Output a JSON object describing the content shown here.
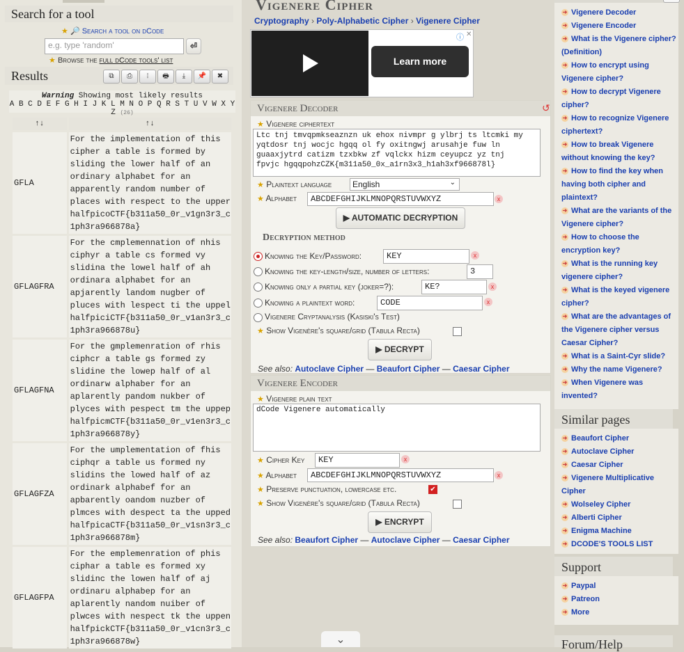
{
  "search": {
    "header": "Search for a tool",
    "link_label": "🔎 Search a tool on dCode",
    "placeholder": "e.g. type 'random'",
    "go_label": "⏎",
    "browse_prefix": "Browse the",
    "browse_link": "full dCode tools' list"
  },
  "results": {
    "header": "Results",
    "toolbar": [
      "⧉",
      "⎙",
      "⦙",
      "🖶",
      "⤓",
      "📌",
      "✖"
    ],
    "warning_label": "Warning",
    "warning_text": "Showing most likely results",
    "alphabet": "A B C D E F G H I J K L M N O P Q R S T U V W X Y Z",
    "alphabet_count": "(26)",
    "col_headers": [
      "↑↓",
      "↑↓"
    ],
    "rows": [
      {
        "key": "GFLA",
        "text": "For the implementation of this\ncipher a table is formed by\nsliding the lower half of an\nordinary alphabet for an\napparently random number of\nplaces with respect to the upper\nhalfpicoCTF{b311a50_0r_v1gn3r3_c\n1ph3ra966878a}"
      },
      {
        "key": "GFLAGFRA",
        "text": "For the cmplemennation of nhis\nciphyr a table cs formed vy\nslidina the lowel half of ah\nordinara alphabet for an\napjarently landom nugber of\npluces with lespect ti the uppel\nhalfpiciCTF{b311a50_0r_v1an3r3_c\n1ph3ra966878u}"
      },
      {
        "key": "GFLAGFNA",
        "text": "For the gmplemenration of rhis\nciphcr a table gs formed zy\nslidine the lowep half of al\nordinarw alphaber for an\naplarently pandom nukber of\nplyces with pespect tm the uppep\nhalfpicmCTF{b311a50_0r_v1en3r3_c\n1ph3ra966878y}"
      },
      {
        "key": "GFLAGFZA",
        "text": "For the umplementation of fhis\nciphqr a table us formed ny\nslidins the lowed half of az\nordinark alphabef for an\napbarently oandom nuzber of\nplmces with despect ta the upped\nhalfpicaCTF{b311a50_0r_v1sn3r3_c\n1ph3ra966878m}"
      },
      {
        "key": "GFLAGFPA",
        "text": "For the emplemenration of phis\nciphar a table es formed xy\nslidinc the lowen half of aj\nordinaru alphabep for an\naplarently nandom nuiber of\nplwces with nespect tk the uppen\nhalfpickCTF{b311a50_0r_v1cn3r3_c\n1ph3ra966878w}"
      }
    ]
  },
  "title": {
    "heading": "Vigenere Cipher",
    "breadcrumb": [
      "Cryptography",
      "Poly-Alphabetic Cipher",
      "Vigenere Cipher"
    ],
    "ad_button": "Learn more"
  },
  "decoder": {
    "header": "Vigenere Decoder",
    "ciphertext_label": "Vigenere ciphertext",
    "ciphertext": "Ltc tnj tmvqpmkseaznzn uk ehox nivmpr g ylbrj ts ltcmki my\nyqtdosr tnj wocjc hgqq ol fy oxitngwj arusahje fuw ln\nguaaxjytrd catizm tzxbkw zf vqlckx hizm ceyupcz yz tnj\nfpvjc hgqqpohzCZK{m311a50_0x_a1rn3x3_h1ah3xf966878l}",
    "lang_label": "Plaintext language",
    "lang_value": "English",
    "alphabet_label": "Alphabet",
    "alphabet_value": "ABCDEFGHIJKLMNOPQRSTUVWXYZ",
    "auto_button": "▶ AUTOMATIC DECRYPTION",
    "method_header": "Decryption method",
    "method_options": [
      {
        "label": "Knowing the Key/Password:",
        "value": "KEY"
      },
      {
        "label": "Knowing the key-length/size, number of letters:",
        "value": "3"
      },
      {
        "label": "Knowing only a partial key (joker=?):",
        "value": "KE?"
      },
      {
        "label": "Knowing a plaintext word:",
        "value": "CODE"
      },
      {
        "label": "Vigenere Cryptanalysis (Kasiski's Test)",
        "value": ""
      }
    ],
    "show_grid_label": "Show Vigenère's square/grid (Tabula Recta)",
    "decrypt_button": "▶ DECRYPT",
    "see_also_label": "See also:",
    "see_also": [
      "Autoclave Cipher",
      "Beaufort Cipher",
      "Caesar Cipher"
    ]
  },
  "encoder": {
    "header": "Vigenere Encoder",
    "plain_label": "Vigenere plain text",
    "plain_value": "dCode Vigenere automatically",
    "key_label": "Cipher Key",
    "key_value": "KEY",
    "alphabet_label": "Alphabet",
    "alphabet_value": "ABCDEFGHIJKLMNOPQRSTUVWXYZ",
    "preserve_label": "Preserve punctuation, lowercase etc.",
    "show_grid_label": "Show Vigenère's square/grid (Tabula Recta)",
    "encrypt_button": "▶ ENCRYPT",
    "see_also_label": "See also:",
    "see_also": [
      "Beaufort Cipher",
      "Autoclave Cipher",
      "Caesar Cipher"
    ]
  },
  "faq": [
    "Vigenere Decoder",
    "Vigenere Encoder",
    "What is the Vigenere cipher? (Definition)",
    "How to encrypt using Vigenere cipher?",
    "How to decrypt Vigenere cipher?",
    "How to recognize Vigenere ciphertext?",
    "How to break Vigenere without knowing the key?",
    "How to find the key when having both cipher and plaintext?",
    "What are the variants of the Vigenere cipher?",
    "How to choose the encryption key?",
    "What is the running key vigenere cipher?",
    "What is the keyed vigenere cipher?",
    "What are the advantages of the Vigenere cipher versus Caesar Cipher?",
    "What is a Saint-Cyr slide?",
    "Why the name Vigenere?",
    "When Vigenere was invented?"
  ],
  "similar": {
    "header": "Similar pages",
    "items": [
      "Beaufort Cipher",
      "Autoclave Cipher",
      "Caesar Cipher",
      "Vigenere Multiplicative Cipher",
      "Wolseley Cipher",
      "Alberti Cipher",
      "Enigma Machine",
      "DCODE'S TOOLS LIST"
    ]
  },
  "support": {
    "header": "Support",
    "items": [
      "Paypal",
      "Patreon",
      "More"
    ]
  },
  "forum": {
    "header": "Forum/Help"
  },
  "colors": {
    "link": "#1a3fb0",
    "star": "#d9a200",
    "bg": "#d6d3c8"
  }
}
